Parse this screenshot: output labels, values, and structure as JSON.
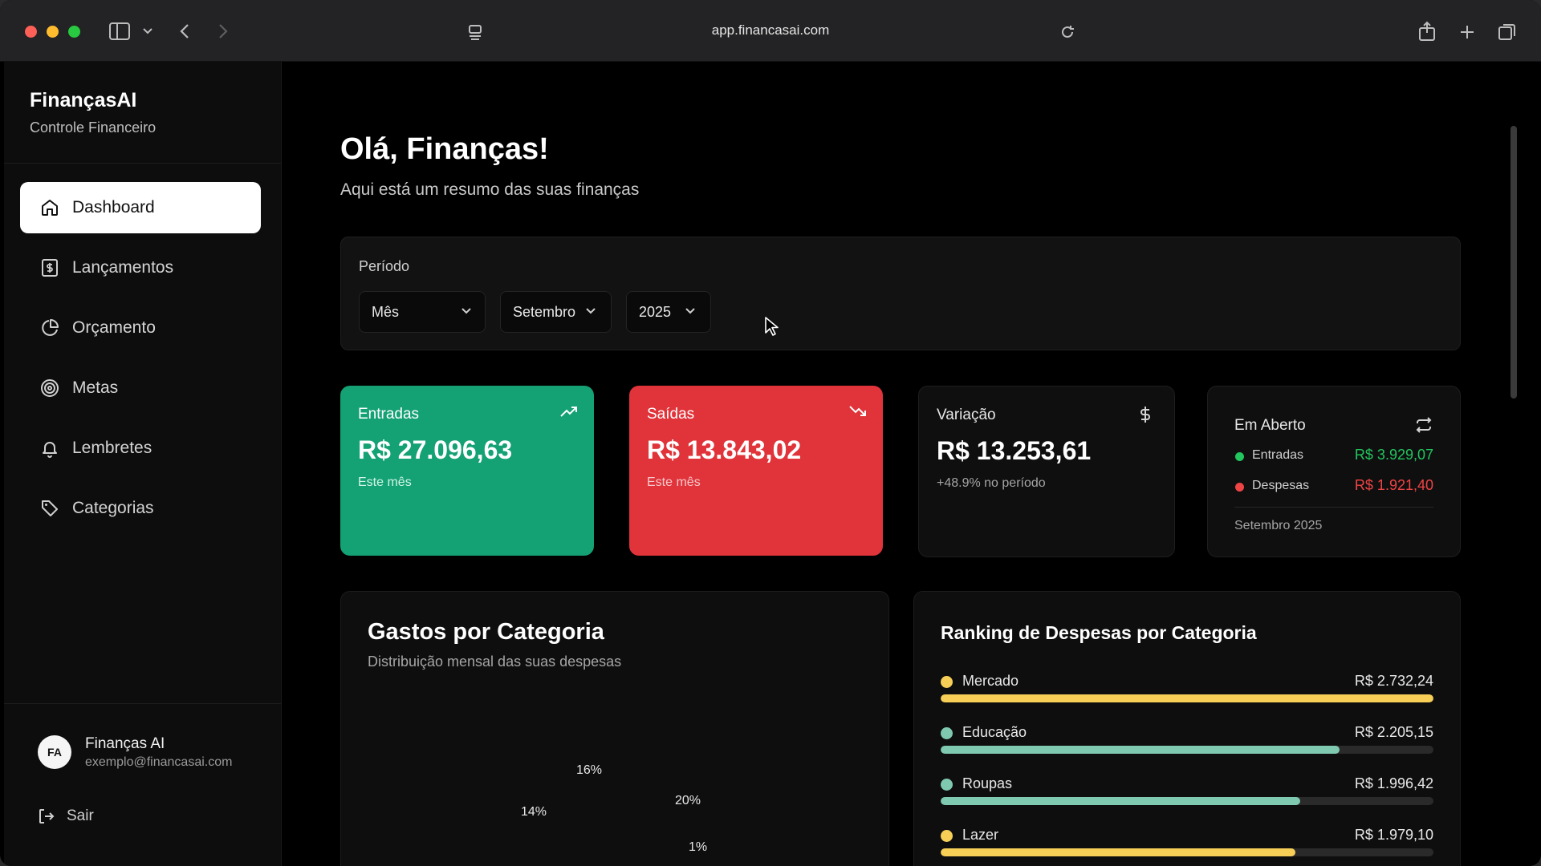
{
  "browser": {
    "url": "app.financasai.com"
  },
  "sidebar": {
    "brand": "FinançasAI",
    "brand_sub": "Controle Financeiro",
    "items": [
      {
        "label": "Dashboard",
        "icon": "home-icon"
      },
      {
        "label": "Lançamentos",
        "icon": "dollar-icon"
      },
      {
        "label": "Orçamento",
        "icon": "pie-icon"
      },
      {
        "label": "Metas",
        "icon": "target-icon"
      },
      {
        "label": "Lembretes",
        "icon": "bell-icon"
      },
      {
        "label": "Categorias",
        "icon": "tag-icon"
      }
    ],
    "user": {
      "initials": "FA",
      "name": "Finanças AI",
      "email": "exemplo@financasai.com"
    },
    "logout": "Sair"
  },
  "header": {
    "title": "Olá, Finanças!",
    "subtitle": "Aqui está um resumo das suas finanças"
  },
  "period": {
    "label": "Período",
    "mode": "Mês",
    "month": "Setembro",
    "year": "2025"
  },
  "stats": {
    "income": {
      "label": "Entradas",
      "value": "R$ 27.096,63",
      "note": "Este mês"
    },
    "expense": {
      "label": "Saídas",
      "value": "R$ 13.843,02",
      "note": "Este mês"
    },
    "variation": {
      "label": "Variação",
      "value": "R$ 13.253,61",
      "note": "+48.9% no período"
    },
    "open": {
      "label": "Em Aberto",
      "income_label": "Entradas",
      "income_value": "R$ 3.929,07",
      "expense_label": "Despesas",
      "expense_value": "R$ 1.921,40",
      "period": "Setembro 2025"
    }
  },
  "colors": {
    "income": "#14a174",
    "expense": "#e0333a",
    "income_text": "#22c55e",
    "expense_text": "#ef4444"
  },
  "category_chart": {
    "title": "Gastos por Categoria",
    "subtitle": "Distribuição mensal das suas despesas",
    "labels": [
      "16%",
      "14%",
      "20%",
      "1%"
    ]
  },
  "ranking": {
    "title": "Ranking de Despesas por Categoria",
    "items": [
      {
        "name": "Mercado",
        "value": "R$ 2.732,24",
        "fraction": 1.0,
        "color": "#f7cf57"
      },
      {
        "name": "Educação",
        "value": "R$ 2.205,15",
        "fraction": 0.81,
        "color": "#7ec9b0"
      },
      {
        "name": "Roupas",
        "value": "R$ 1.996,42",
        "fraction": 0.73,
        "color": "#7ec9b0"
      },
      {
        "name": "Lazer",
        "value": "R$ 1.979,10",
        "fraction": 0.72,
        "color": "#f7cf57"
      }
    ]
  }
}
